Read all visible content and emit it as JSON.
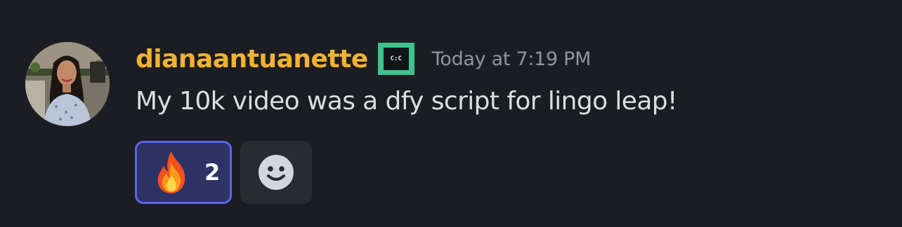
{
  "message": {
    "author": "dianaantuanette",
    "role_badge": {
      "text": "C:C",
      "icon": "role-badge-icon",
      "color": "#3ec28f"
    },
    "timestamp": "Today at 7:19 PM",
    "content": "My 10k video was a dfy script for lingo leap!",
    "reactions": [
      {
        "emoji": "fire",
        "count": "2",
        "selected": true
      }
    ],
    "add_reaction_icon": "smiley-icon"
  },
  "colors": {
    "background": "#1c1d22",
    "username": "#f0b232",
    "timestamp": "#92949d",
    "text": "#dbdee1",
    "reaction_border": "#5965f2",
    "reaction_bg": "#2f3264"
  }
}
